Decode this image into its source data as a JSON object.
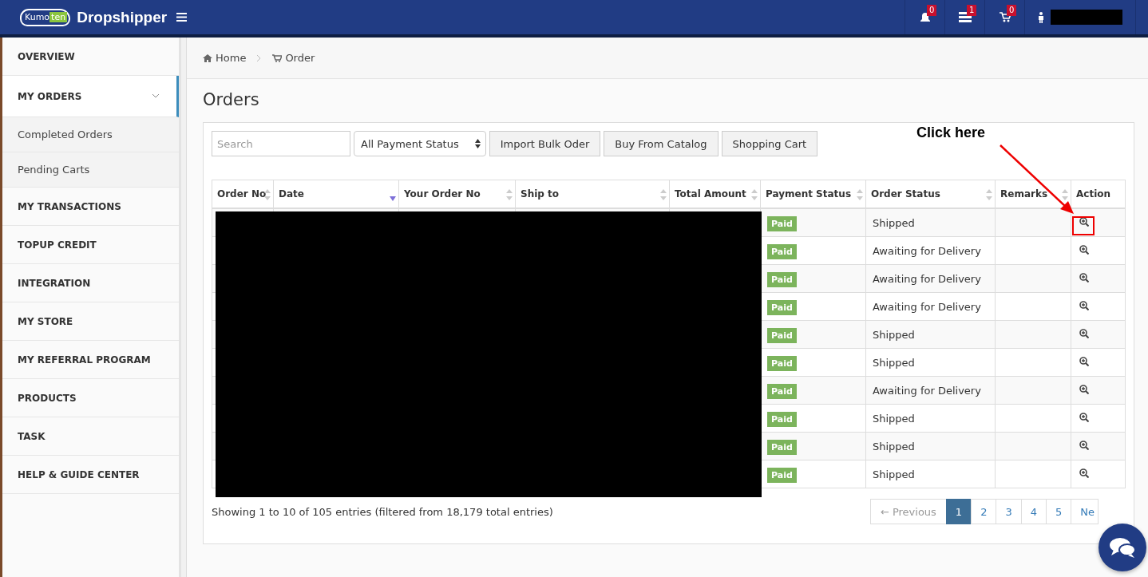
{
  "header": {
    "logo": {
      "word_1": "Kumo",
      "word_2": "ten"
    },
    "brand": "Dropshipper",
    "notifications": [
      {
        "kind": "bell",
        "count": "0"
      },
      {
        "kind": "messages",
        "count": "1"
      },
      {
        "kind": "cart",
        "count": "0"
      }
    ]
  },
  "sidebar": {
    "items": [
      {
        "label": "OVERVIEW",
        "expanded": false
      },
      {
        "label": "MY ORDERS",
        "expanded": true,
        "children": [
          {
            "label": "Completed Orders"
          },
          {
            "label": "Pending Carts"
          }
        ]
      },
      {
        "label": "MY TRANSACTIONS",
        "expanded": false
      },
      {
        "label": "TOPUP CREDIT",
        "expanded": false
      },
      {
        "label": "INTEGRATION",
        "expanded": false
      },
      {
        "label": "MY STORE",
        "expanded": false
      },
      {
        "label": "MY REFERRAL PROGRAM",
        "expanded": false
      },
      {
        "label": "PRODUCTS",
        "expanded": false
      },
      {
        "label": "TASK",
        "expanded": false
      },
      {
        "label": "HELP & GUIDE CENTER",
        "expanded": false
      }
    ]
  },
  "breadcrumb": [
    {
      "kind": "home",
      "label": "Home"
    },
    {
      "kind": "cart",
      "label": "Order"
    }
  ],
  "page_title": "Orders",
  "toolbar": {
    "search": {
      "placeholder": "Search"
    },
    "filter": "All Payment Status",
    "buttons": [
      "Import Bulk Oder",
      "Buy From Catalog",
      "Shopping Cart"
    ]
  },
  "table": {
    "columns": [
      {
        "label": "Order No",
        "sortable": true,
        "sorted": false
      },
      {
        "label": "Date",
        "sortable": true,
        "sorted": true
      },
      {
        "label": "Your Order No",
        "sortable": true,
        "sorted": false
      },
      {
        "label": "Ship to",
        "sortable": true,
        "sorted": false
      },
      {
        "label": "Total Amount",
        "sortable": true,
        "sorted": false
      },
      {
        "label": "Payment Status",
        "sortable": true,
        "sorted": false
      },
      {
        "label": "Order Status",
        "sortable": true,
        "sorted": false
      },
      {
        "label": "Remarks",
        "sortable": true,
        "sorted": false
      },
      {
        "label": "Action",
        "sortable": false,
        "sorted": false
      }
    ],
    "rows": [
      {
        "payment_status": "Paid",
        "order_status": "Shipped"
      },
      {
        "payment_status": "Paid",
        "order_status": "Awaiting for Delivery"
      },
      {
        "payment_status": "Paid",
        "order_status": "Awaiting for Delivery"
      },
      {
        "payment_status": "Paid",
        "order_status": "Awaiting for Delivery"
      },
      {
        "payment_status": "Paid",
        "order_status": "Shipped"
      },
      {
        "payment_status": "Paid",
        "order_status": "Shipped"
      },
      {
        "payment_status": "Paid",
        "order_status": "Awaiting for Delivery"
      },
      {
        "payment_status": "Paid",
        "order_status": "Shipped"
      },
      {
        "payment_status": "Paid",
        "order_status": "Shipped"
      },
      {
        "payment_status": "Paid",
        "order_status": "Shipped"
      }
    ]
  },
  "info": "Showing 1 to 10 of 105 entries (filtered from 18,179 total entries)",
  "pagination": {
    "previous": "← Previous",
    "pages": [
      {
        "label": "1",
        "selected": true
      },
      {
        "label": "2",
        "selected": false
      },
      {
        "label": "3",
        "selected": false
      },
      {
        "label": "4",
        "selected": false
      },
      {
        "label": "5",
        "selected": false
      }
    ],
    "next": "Ne"
  },
  "annotation": {
    "text": "Click here"
  }
}
